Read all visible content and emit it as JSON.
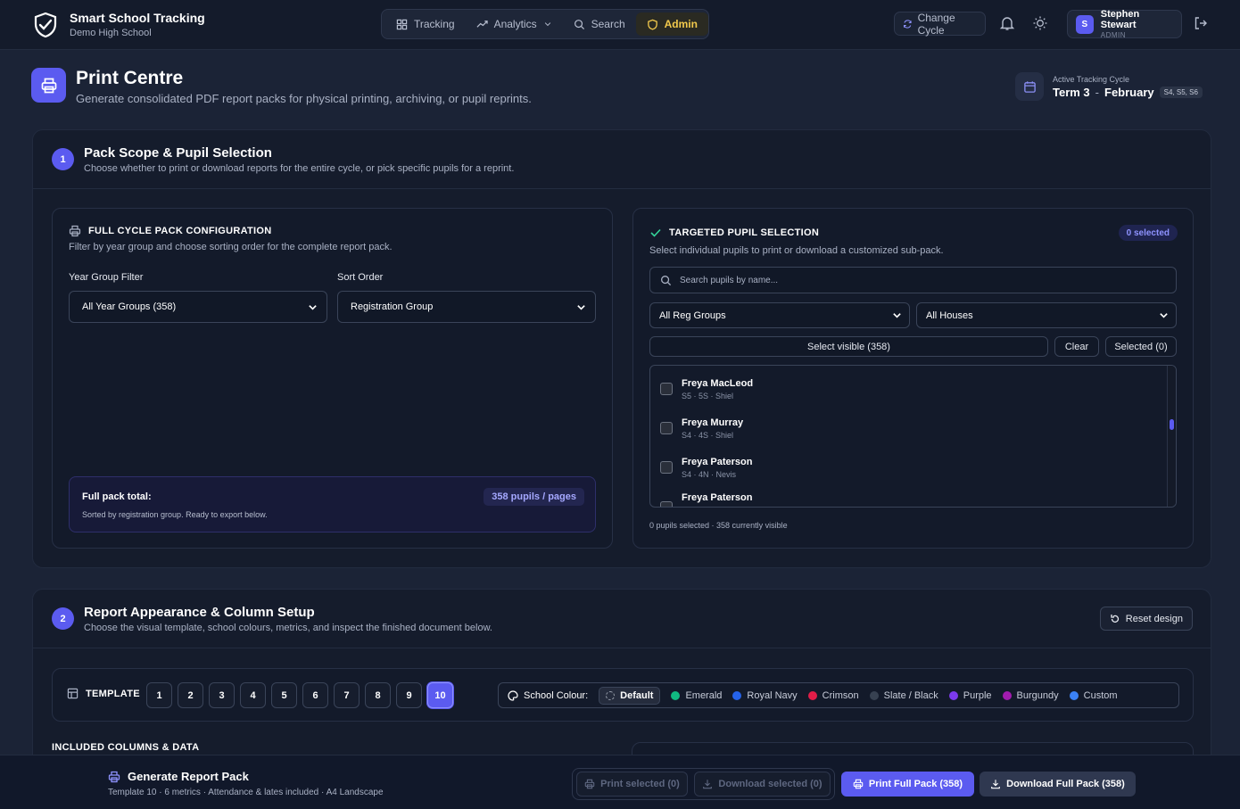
{
  "app": {
    "title": "Smart School Tracking",
    "school": "Demo High School"
  },
  "nav": {
    "tracking": "Tracking",
    "analytics": "Analytics",
    "search": "Search",
    "admin": "Admin"
  },
  "topright": {
    "change_cycle": "Change Cycle",
    "user_initial": "S",
    "user_name": "Stephen Stewart",
    "user_role": "ADMIN"
  },
  "header": {
    "title": "Print Centre",
    "subtitle": "Generate consolidated PDF report packs for physical printing, archiving, or pupil reprints.",
    "cycle_label": "Active Tracking Cycle",
    "cycle_term": "Term 3",
    "cycle_sep": "-",
    "cycle_month": "February",
    "cycle_years": "S4, S5, S6"
  },
  "section1": {
    "step": "1",
    "title": "Pack Scope & Pupil Selection",
    "subtitle": "Choose whether to print or download reports for the entire cycle, or pick specific pupils for a reprint.",
    "full": {
      "title": "FULL CYCLE PACK CONFIGURATION",
      "hint": "Filter by year group and choose sorting order for the complete report pack.",
      "year_label": "Year Group Filter",
      "year_value": "All Year Groups (358)",
      "sort_label": "Sort Order",
      "sort_value": "Registration Group",
      "total_label": "Full pack total:",
      "total_value": "358 pupils / pages",
      "total_note": "Sorted by registration group. Ready to export below."
    },
    "targeted": {
      "title": "TARGETED PUPIL SELECTION",
      "badge": "0 selected",
      "hint": "Select individual pupils to print or download a customized sub-pack.",
      "search_placeholder": "Search pupils by name...",
      "reg_filter": "All Reg Groups",
      "house_filter": "All Houses",
      "select_visible": "Select visible (358)",
      "clear": "Clear",
      "selected": "Selected (0)",
      "pupils": [
        {
          "name": "Freya MacLeod",
          "meta": "S5 · 5S · Shiel"
        },
        {
          "name": "Freya Murray",
          "meta": "S4 · 4S · Shiel"
        },
        {
          "name": "Freya Paterson",
          "meta": "S4 · 4N · Nevis"
        },
        {
          "name": "Freya Paterson",
          "meta": ""
        }
      ],
      "footer": "0 pupils selected · 358 currently visible"
    }
  },
  "section2": {
    "step": "2",
    "title": "Report Appearance & Column Setup",
    "subtitle": "Choose the visual template, school colours, metrics, and inspect the finished document below.",
    "reset": "Reset design",
    "template_label": "TEMPLATE",
    "templates": [
      "1",
      "2",
      "3",
      "4",
      "5",
      "6",
      "7",
      "8",
      "9",
      "10"
    ],
    "active_template": "10",
    "colour_label": "School Colour:",
    "colours": [
      {
        "name": "Default",
        "color": "#6b7280"
      },
      {
        "name": "Emerald",
        "color": "#10b981"
      },
      {
        "name": "Royal Navy",
        "color": "#2563eb"
      },
      {
        "name": "Crimson",
        "color": "#e11d48"
      },
      {
        "name": "Slate / Black",
        "color": "#374151"
      },
      {
        "name": "Purple",
        "color": "#7c3aed"
      },
      {
        "name": "Burgundy",
        "color": "#a21caf"
      },
      {
        "name": "Custom",
        "color": "#3b82f6"
      }
    ],
    "included_label": "INCLUDED COLUMNS & DATA"
  },
  "footer": {
    "title": "Generate Report Pack",
    "subtitle": "Template 10 · 6 metrics · Attendance & lates included · A4 Landscape",
    "print_selected": "Print selected (0)",
    "download_selected": "Download selected (0)",
    "print_full": "Print Full Pack (358)",
    "download_full": "Download Full Pack (358)"
  }
}
